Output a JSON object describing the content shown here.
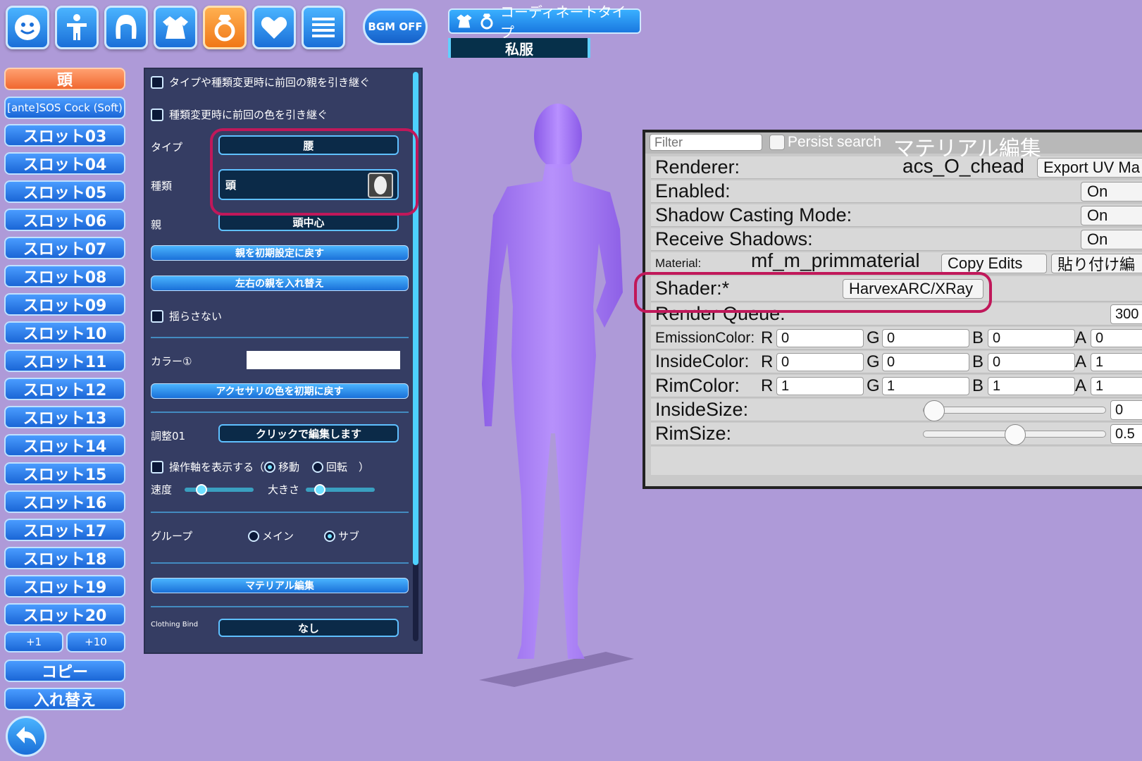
{
  "toolbar": {
    "icons": [
      "face-icon",
      "body-icon",
      "hair-icon",
      "clothing-icon",
      "accessory-ring-icon",
      "heart-icon",
      "menu-icon"
    ],
    "bgm_label": "BGM OFF",
    "coordinate_type_label": "コーディネートタイプ",
    "coordinate_value": "私服"
  },
  "slots": {
    "active": "頭",
    "second": "[ante]SOS Cock (Soft)",
    "items": [
      "スロット03",
      "スロット04",
      "スロット05",
      "スロット06",
      "スロット07",
      "スロット08",
      "スロット09",
      "スロット10",
      "スロット11",
      "スロット12",
      "スロット13",
      "スロット14",
      "スロット15",
      "スロット16",
      "スロット17",
      "スロット18",
      "スロット19",
      "スロット20"
    ],
    "plus1": "+1",
    "plus10": "+10",
    "copy": "コピー",
    "swap": "入れ替え"
  },
  "panel": {
    "keep_parent": "タイプや種類変更時に前回の親を引き継ぐ",
    "keep_color": "種類変更時に前回の色を引き継ぐ",
    "type_label": "タイプ",
    "type_value": "腰",
    "kind_label": "種類",
    "kind_value": "頭",
    "parent_label": "親",
    "parent_value": "頭中心",
    "reset_parent": "親を初期設定に戻す",
    "swap_lr": "左右の親を入れ替え",
    "no_sway": "揺らさない",
    "color_label": "カラー①",
    "reset_color": "アクセサリの色を初期に戻す",
    "adjust_label": "調整01",
    "adjust_value": "クリックで編集します",
    "show_axis": "操作軸を表示する（",
    "move": "移動",
    "rotate": "回転",
    "close_paren": "）",
    "speed": "速度",
    "size": "大きさ",
    "speed_level": 0.2,
    "size_level": 0.15,
    "group": "グループ",
    "main": "メイン",
    "sub": "サブ",
    "material_edit": "マテリアル編集",
    "clothing_bind": "Clothing Bind",
    "clothing_bind_value": "なし"
  },
  "material": {
    "filter_placeholder": "Filter",
    "persist": "Persist search",
    "title": "マテリアル編集",
    "renderer_label": "Renderer:",
    "renderer_value": "acs_O_chead",
    "export_uv": "Export UV Ma",
    "enabled_label": "Enabled:",
    "enabled_value": "On",
    "shadow_label": "Shadow Casting Mode:",
    "shadow_value": "On",
    "receive_label": "Receive Shadows:",
    "receive_value": "On",
    "material_label": "Material:",
    "material_value": "mf_m_primmaterial",
    "copy_edits": "Copy Edits",
    "paste_edits": "貼り付け編",
    "shader_label": "Shader:*",
    "shader_value": "HarvexARC/XRay",
    "queue_label": "Render Queue:",
    "queue_value": "300",
    "emission_label": "EmissionColor:",
    "emission": [
      "0",
      "0",
      "0",
      "0"
    ],
    "inside_label": "InsideColor:",
    "inside": [
      "0",
      "0",
      "0",
      "1"
    ],
    "rim_label": "RimColor:",
    "rim": [
      "1",
      "1",
      "1",
      "1"
    ],
    "inside_size_label": "InsideSize:",
    "inside_size_value": "0",
    "rim_size_label": "RimSize:",
    "rim_size_value": "0.5",
    "channels": [
      "R",
      "G",
      "B",
      "A"
    ]
  },
  "colors": {
    "background": "#ae9ad8",
    "accent_blue": "#1a70d8",
    "active_orange": "#f06830",
    "annotation": "#c0185a",
    "figure": "#a070f0"
  }
}
